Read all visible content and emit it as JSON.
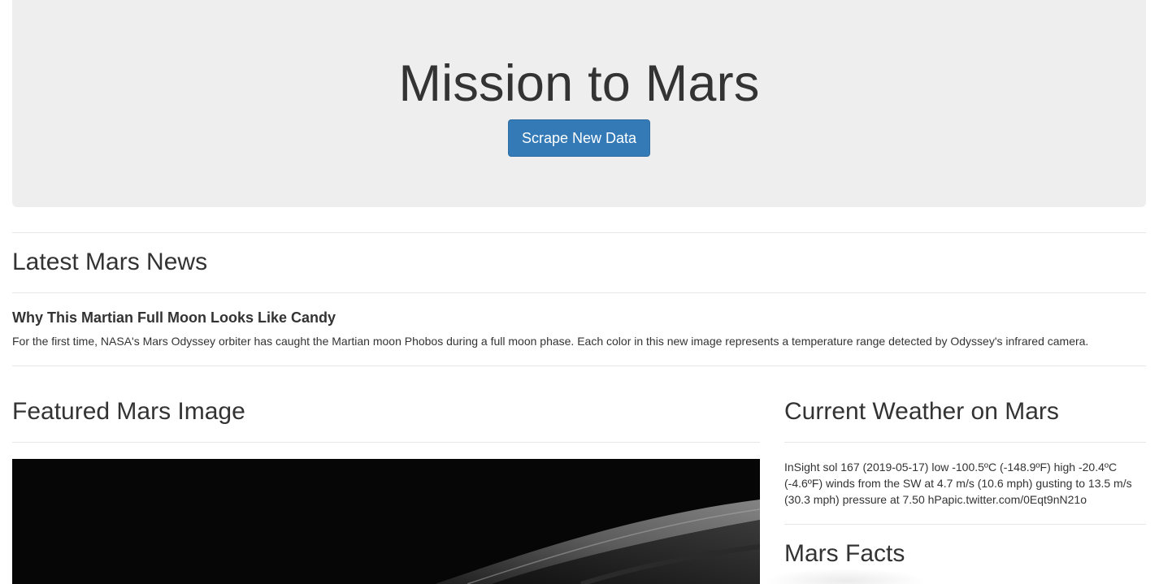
{
  "header": {
    "title": "Mission to Mars",
    "scrape_button_label": "Scrape New Data"
  },
  "news": {
    "section_title": "Latest Mars News",
    "article_title": "Why This Martian Full Moon Looks Like Candy",
    "article_body": "For the first time, NASA's Mars Odyssey orbiter has caught the Martian moon Phobos during a full moon phase. Each color in this new image represents a temperature range detected by Odyssey's infrared camera."
  },
  "featured": {
    "section_title": "Featured Mars Image"
  },
  "weather": {
    "section_title": "Current Weather on Mars",
    "text": "InSight sol 167 (2019-05-17) low -100.5ºC (-148.9ºF) high -20.4ºC (-4.6ºF) winds from the SW at 4.7 m/s (10.6 mph) gusting to 13.5 m/s (30.3 mph) pressure at 7.50 hPapic.twitter.com/0Eqt9nN21o"
  },
  "facts": {
    "section_title": "Mars Facts"
  },
  "colors": {
    "jumbotron_bg": "#eeeeee",
    "button_primary": "#337ab7",
    "text": "#333333"
  }
}
